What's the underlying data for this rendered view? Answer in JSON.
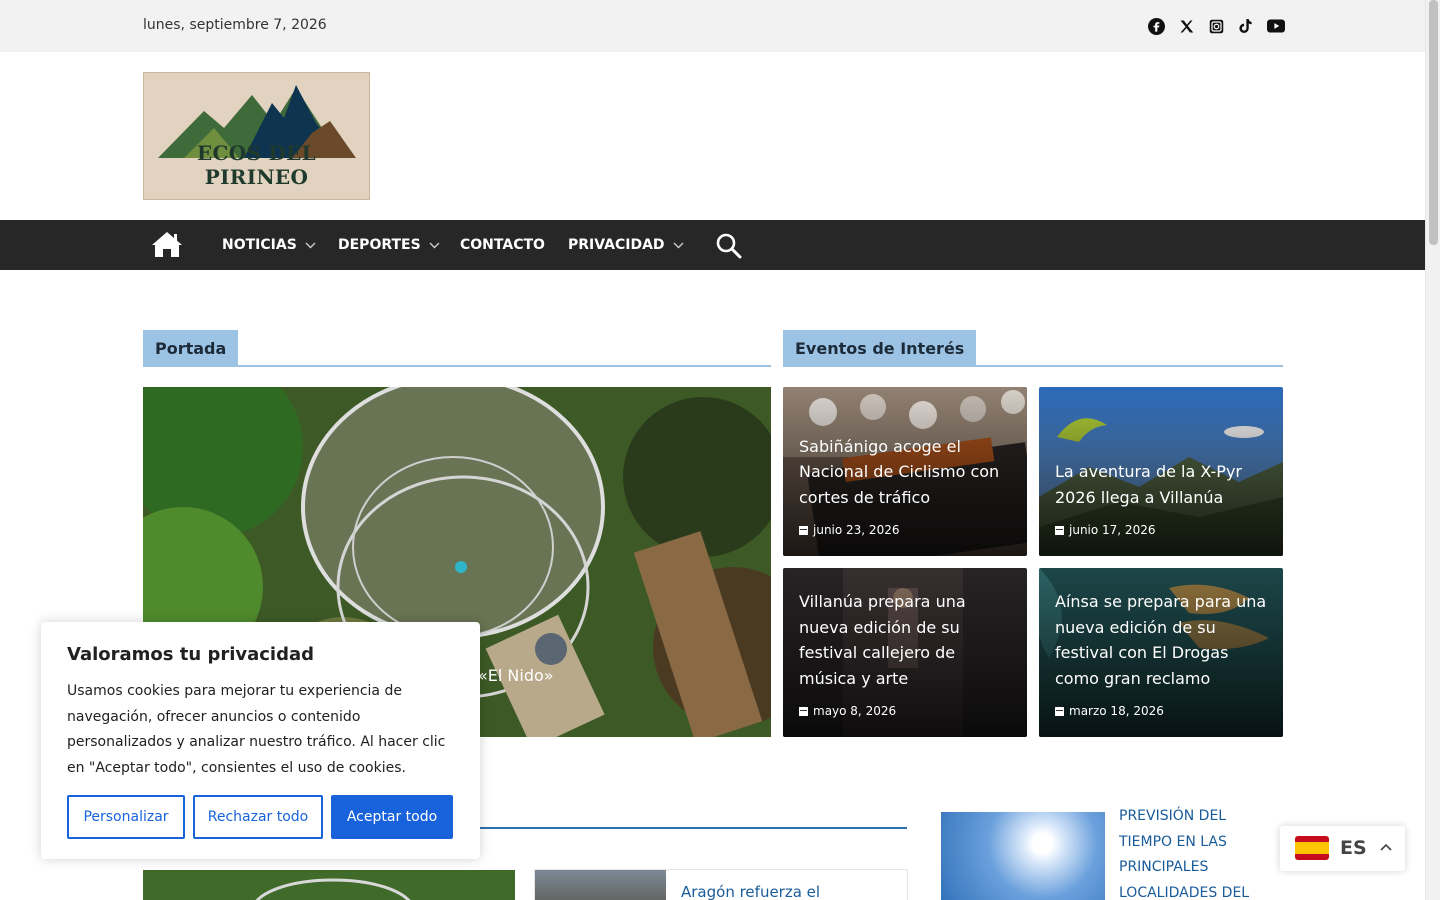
{
  "topbar": {
    "date": "lunes, septiembre 7, 2026",
    "social_icons": [
      "facebook-icon",
      "x-icon",
      "instagram-icon",
      "tiktok-icon",
      "youtube-icon"
    ]
  },
  "logo": {
    "text": "ECOS DEL PIRINEO"
  },
  "nav": {
    "items": [
      {
        "label": "NOTICIAS",
        "has_dropdown": true
      },
      {
        "label": "DEPORTES",
        "has_dropdown": true
      },
      {
        "label": "CONTACTO",
        "has_dropdown": false
      },
      {
        "label": "PRIVACIDAD",
        "has_dropdown": true
      }
    ]
  },
  "portada": {
    "title": "Portada",
    "hero_title_visible": "«El Nido»"
  },
  "eventos": {
    "title": "Eventos de Interés",
    "cards": [
      {
        "title": "Sabiñánigo acoge el Nacional de Ciclismo con cortes de tráfico",
        "date": "junio 23, 2026"
      },
      {
        "title": "La aventura de la X-Pyr 2026 llega a Villanúa",
        "date": "junio 17, 2026"
      },
      {
        "title": "Villanúa prepara una nueva edición de su festival callejero de música y arte",
        "date": "mayo 8, 2026"
      },
      {
        "title": "Aínsa se prepara para una nueva edición de su festival con El Drogas como gran reclamo",
        "date": "marzo 18, 2026"
      }
    ]
  },
  "lower": {
    "list_title": "Aragón refuerza el",
    "weather_title": "PREVISIÓN DEL TIEMPO EN LAS PRINCIPALES LOCALIDADES DEL"
  },
  "cookie": {
    "title": "Valoramos tu privacidad",
    "body": "Usamos cookies para mejorar tu experiencia de navegación, ofrecer anuncios o contenido personalizados y analizar nuestro tráfico. Al hacer clic en \"Aceptar todo\", consientes el uso de cookies.",
    "customize": "Personalizar",
    "reject": "Rechazar todo",
    "accept": "Aceptar todo",
    "accent": "#1863dc"
  },
  "lang": {
    "code": "ES"
  }
}
